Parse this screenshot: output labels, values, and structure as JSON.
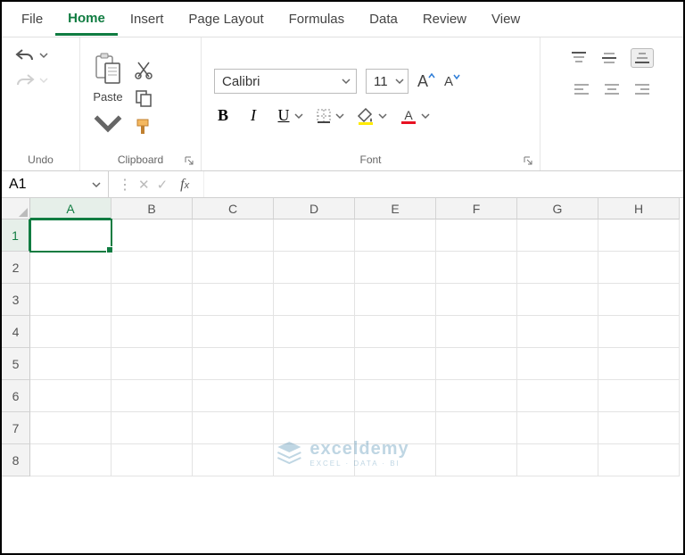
{
  "tabs": [
    "File",
    "Home",
    "Insert",
    "Page Layout",
    "Formulas",
    "Data",
    "Review",
    "View"
  ],
  "activeTab": "Home",
  "ribbon": {
    "undo": {
      "label": "Undo"
    },
    "clipboard": {
      "label": "Clipboard",
      "paste": "Paste"
    },
    "font": {
      "label": "Font",
      "name": "Calibri",
      "size": "11",
      "bold": "B",
      "italic": "I",
      "underline": "U",
      "increase": "A",
      "decrease": "A"
    },
    "alignment": {
      "label": ""
    }
  },
  "namebox": "A1",
  "formula": "",
  "columns": [
    "A",
    "B",
    "C",
    "D",
    "E",
    "F",
    "G",
    "H"
  ],
  "rows": [
    "1",
    "2",
    "3",
    "4",
    "5",
    "6",
    "7",
    "8"
  ],
  "selectedCell": "A1",
  "watermark": {
    "brand": "exceldemy",
    "sub": "EXCEL · DATA · BI"
  }
}
